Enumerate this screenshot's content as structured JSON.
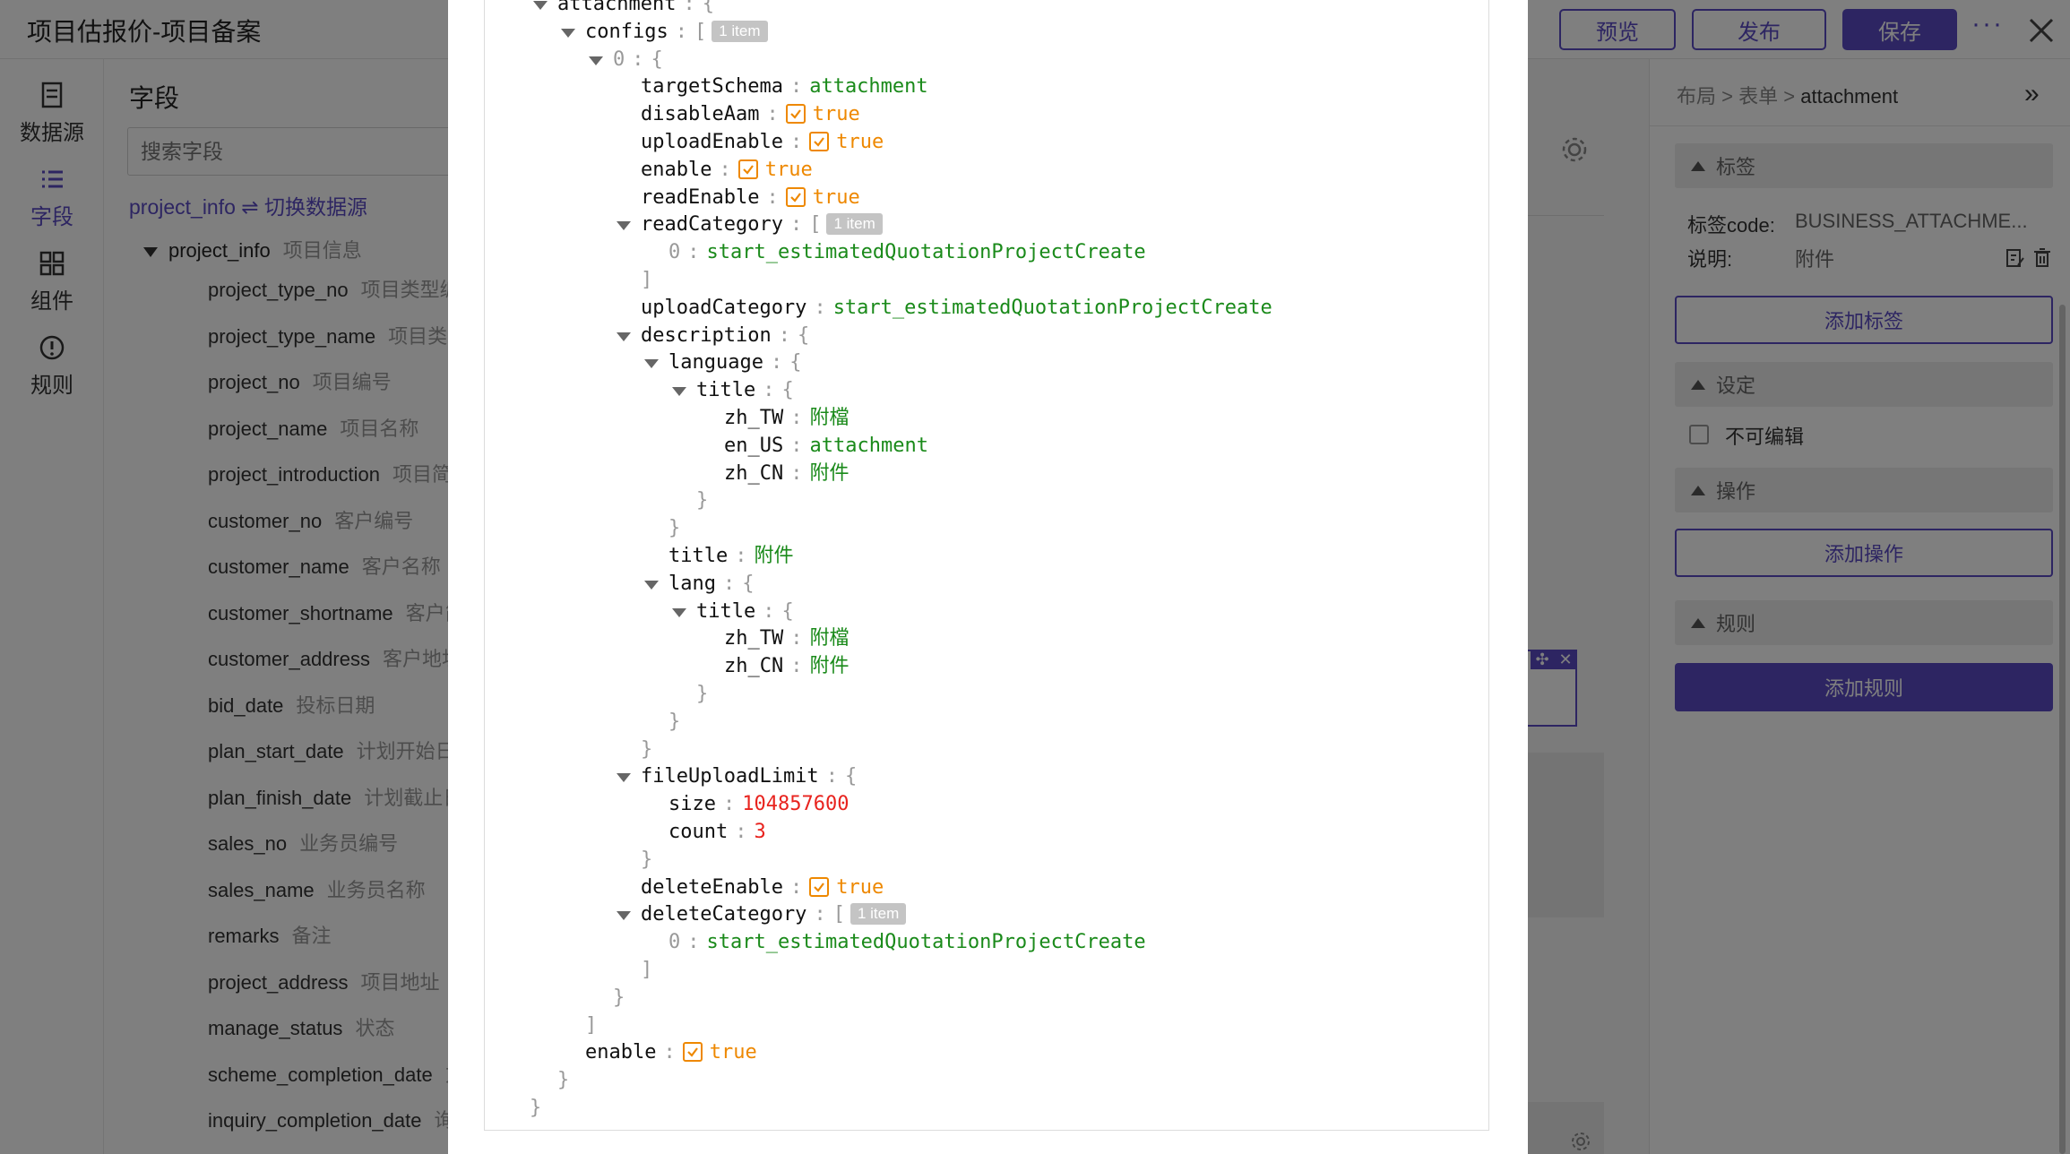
{
  "app": {
    "title": "项目估报价-项目备案",
    "toolbar": {
      "preview": "预览",
      "publish": "发布",
      "save": "保存"
    }
  },
  "nav": [
    {
      "label": "数据源",
      "icon": "datasource-icon"
    },
    {
      "label": "字段",
      "icon": "list-icon"
    },
    {
      "label": "组件",
      "icon": "grid-icon"
    },
    {
      "label": "规则",
      "icon": "alert-circle-icon"
    }
  ],
  "fields": {
    "title": "字段",
    "search_placeholder": "搜索字段",
    "datasource_link": "project_info ⇌ 切换数据源",
    "root": {
      "name": "project_info",
      "cn": "项目信息"
    },
    "items": [
      {
        "name": "project_type_no",
        "cn": "项目类型编号"
      },
      {
        "name": "project_type_name",
        "cn": "项目类型名称"
      },
      {
        "name": "project_no",
        "cn": "项目编号"
      },
      {
        "name": "project_name",
        "cn": "项目名称"
      },
      {
        "name": "project_introduction",
        "cn": "项目简介"
      },
      {
        "name": "customer_no",
        "cn": "客户编号"
      },
      {
        "name": "customer_name",
        "cn": "客户名称"
      },
      {
        "name": "customer_shortname",
        "cn": "客户简称"
      },
      {
        "name": "customer_address",
        "cn": "客户地址"
      },
      {
        "name": "bid_date",
        "cn": "投标日期"
      },
      {
        "name": "plan_start_date",
        "cn": "计划开始日期"
      },
      {
        "name": "plan_finish_date",
        "cn": "计划截止日期"
      },
      {
        "name": "sales_no",
        "cn": "业务员编号"
      },
      {
        "name": "sales_name",
        "cn": "业务员名称"
      },
      {
        "name": "remarks",
        "cn": "备注"
      },
      {
        "name": "project_address",
        "cn": "项目地址"
      },
      {
        "name": "manage_status",
        "cn": "状态"
      },
      {
        "name": "scheme_completion_date",
        "cn": "方案完成日期"
      },
      {
        "name": "inquiry_completion_date",
        "cn": "询价完成日期"
      }
    ]
  },
  "props": {
    "breadcrumb": [
      "布局",
      ">",
      "表单",
      ">",
      "attachment"
    ],
    "sections": {
      "label": "标签",
      "setting": "设定",
      "operation": "操作",
      "rule": "规则"
    },
    "label_code_key": "标签code:",
    "label_code_value": "BUSINESS_ATTACHME...",
    "desc_key": "说明:",
    "desc_value": "附件",
    "add_label": "添加标签",
    "readonly_label": "不可编辑",
    "add_operation": "添加操作",
    "add_rule": "添加规则"
  },
  "json_lines": [
    {
      "d": 1,
      "arrow": true,
      "key": "attachment",
      "open": "{"
    },
    {
      "d": 2,
      "arrow": true,
      "key": "configs",
      "open": "[",
      "count": "1 item"
    },
    {
      "d": 3,
      "arrow": true,
      "idx": "0",
      "open": "{"
    },
    {
      "d": 4,
      "key": "targetSchema",
      "str": "attachment"
    },
    {
      "d": 4,
      "key": "disableAam",
      "bool": "true"
    },
    {
      "d": 4,
      "key": "uploadEnable",
      "bool": "true"
    },
    {
      "d": 4,
      "key": "enable",
      "bool": "true"
    },
    {
      "d": 4,
      "key": "readEnable",
      "bool": "true"
    },
    {
      "d": 4,
      "arrow": true,
      "key": "readCategory",
      "open": "[",
      "count": "1 item"
    },
    {
      "d": 5,
      "idx": "0",
      "str": "start_estimatedQuotationProjectCreate"
    },
    {
      "d": 4,
      "close": "]"
    },
    {
      "d": 4,
      "key": "uploadCategory",
      "str": "start_estimatedQuotationProjectCreate"
    },
    {
      "d": 4,
      "arrow": true,
      "key": "description",
      "open": "{"
    },
    {
      "d": 5,
      "arrow": true,
      "key": "language",
      "open": "{"
    },
    {
      "d": 6,
      "arrow": true,
      "key": "title",
      "open": "{"
    },
    {
      "d": 7,
      "key": "zh_TW",
      "str": "附檔"
    },
    {
      "d": 7,
      "key": "en_US",
      "str": "attachment"
    },
    {
      "d": 7,
      "key": "zh_CN",
      "str": "附件"
    },
    {
      "d": 6,
      "close": "}"
    },
    {
      "d": 5,
      "close": "}"
    },
    {
      "d": 5,
      "key": "title",
      "str": "附件"
    },
    {
      "d": 5,
      "arrow": true,
      "key": "lang",
      "open": "{"
    },
    {
      "d": 6,
      "arrow": true,
      "key": "title",
      "open": "{"
    },
    {
      "d": 7,
      "key": "zh_TW",
      "str": "附檔"
    },
    {
      "d": 7,
      "key": "zh_CN",
      "str": "附件"
    },
    {
      "d": 6,
      "close": "}"
    },
    {
      "d": 5,
      "close": "}"
    },
    {
      "d": 4,
      "close": "}"
    },
    {
      "d": 4,
      "arrow": true,
      "key": "fileUploadLimit",
      "open": "{"
    },
    {
      "d": 5,
      "key": "size",
      "num": "104857600"
    },
    {
      "d": 5,
      "key": "count",
      "num": "3"
    },
    {
      "d": 4,
      "close": "}"
    },
    {
      "d": 4,
      "key": "deleteEnable",
      "bool": "true"
    },
    {
      "d": 4,
      "arrow": true,
      "key": "deleteCategory",
      "open": "[",
      "count": "1 item"
    },
    {
      "d": 5,
      "idx": "0",
      "str": "start_estimatedQuotationProjectCreate"
    },
    {
      "d": 4,
      "close": "]"
    },
    {
      "d": 3,
      "close": "}"
    },
    {
      "d": 2,
      "close": "]"
    },
    {
      "d": 2,
      "key": "enable",
      "bool": "true"
    },
    {
      "d": 1,
      "close": "}"
    },
    {
      "d": 0,
      "close": "}"
    }
  ]
}
